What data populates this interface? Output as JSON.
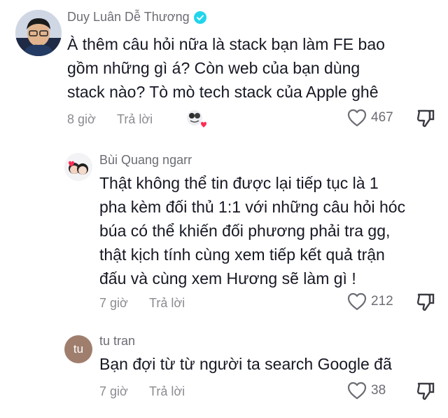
{
  "comments": [
    {
      "username": "Duy Luân Dễ Thương",
      "verified": true,
      "lines": [
        "À thêm câu hỏi nữa là stack bạn làm FE bao",
        "gồm những gì á? Còn web của bạn dùng",
        "stack nào? Tò mò tech stack của Apple ghê"
      ],
      "time": "8 giờ",
      "reply_label": "Trả lời",
      "likes": "467"
    },
    {
      "username": "Bùi Quang ngarr",
      "lines": [
        "Thật không thể tin được lại tiếp tục là 1",
        "pha kèm đối thủ 1:1 với những câu hỏi hóc",
        "búa có thể khiến đối phương phải tra gg,",
        "thật kịch tính cùng xem tiếp kết quả trận",
        "đấu và cùng xem Hương sẽ làm gì !"
      ],
      "time": "7 giờ",
      "reply_label": "Trả lời",
      "likes": "212"
    },
    {
      "username": "tu tran",
      "avatar_initials": "tu",
      "lines": [
        "Bạn đợi từ từ người ta search Google đã"
      ],
      "time": "7 giờ",
      "reply_label": "Trả lời",
      "likes": "38"
    }
  ],
  "colors": {
    "text": "#161823",
    "muted": "#8a8b91",
    "verified": "#20d5ec",
    "like_heart": "#6b6d74",
    "tu_avatar": "#a07e6d"
  }
}
